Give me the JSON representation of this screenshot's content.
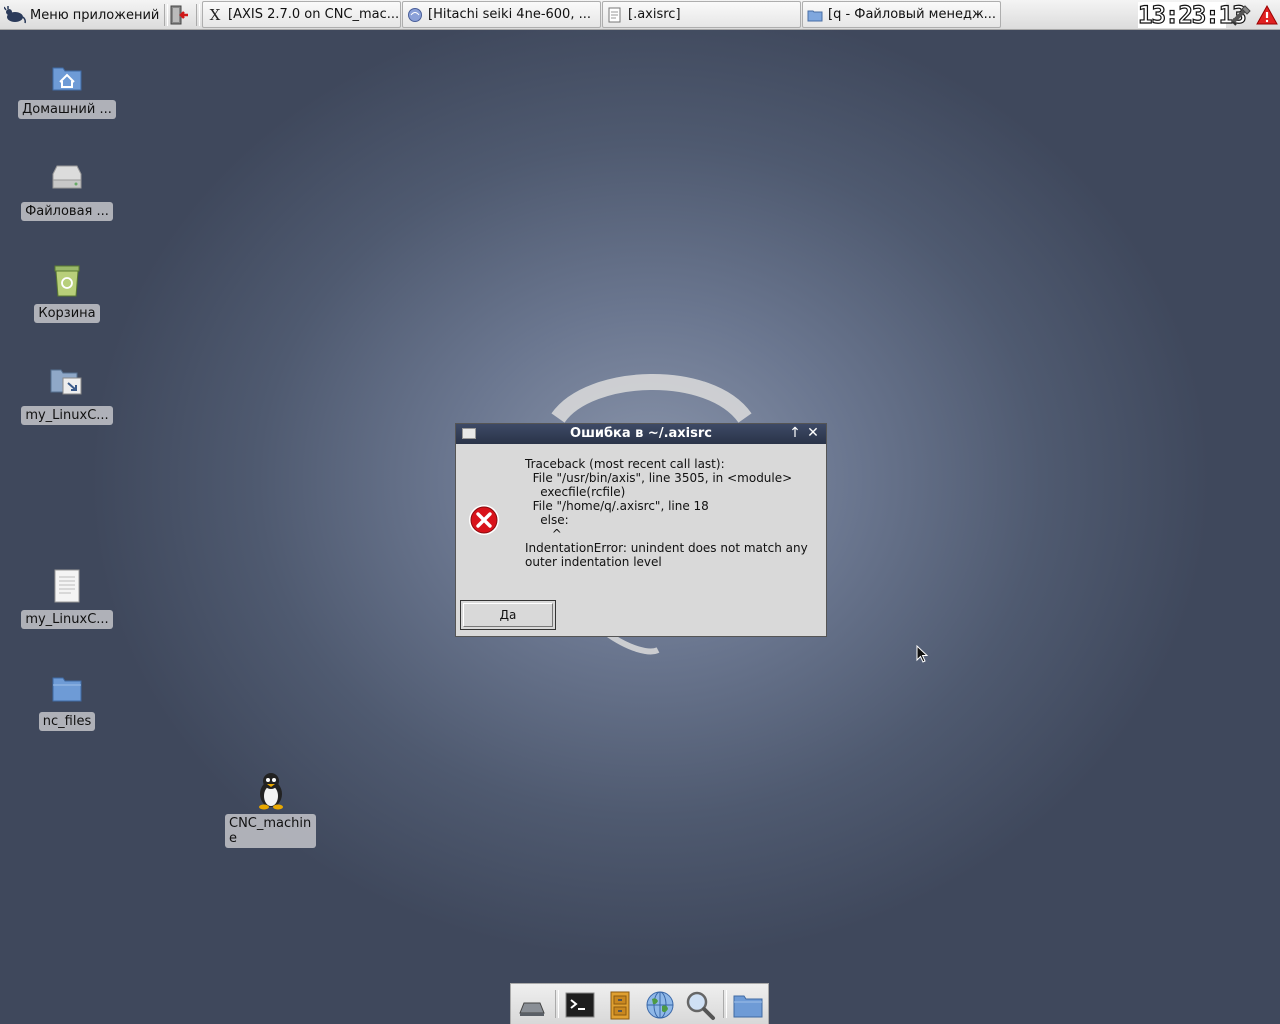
{
  "top_panel": {
    "menu_label": "Меню приложений",
    "tasks": [
      {
        "label": "[AXIS 2.7.0 on CNC_mac...",
        "icon": "x-icon"
      },
      {
        "label": "[Hitachi seiki 4ne-600, ...",
        "icon": "browser-icon"
      },
      {
        "label": "[.axisrc]",
        "icon": "text-editor-icon"
      },
      {
        "label": "[q - Файловый менедж...",
        "icon": "folder-icon"
      }
    ],
    "clock": "13:23:13"
  },
  "desktop_icons": [
    {
      "label": "Домашний ...",
      "icon": "home-folder-icon"
    },
    {
      "label": "Файловая ...",
      "icon": "drive-icon"
    },
    {
      "label": "Корзина",
      "icon": "trash-icon"
    },
    {
      "label": "my_LinuxC...",
      "icon": "folder-link-icon"
    },
    {
      "label": "my_LinuxC...",
      "icon": "text-file-icon"
    },
    {
      "label": "nc_files",
      "icon": "folder-icon"
    },
    {
      "label": "CNC_machine",
      "icon": "linuxcnc-icon"
    }
  ],
  "dialog": {
    "title": "Ошибка в ~/.axisrc",
    "message": "Traceback (most recent call last):\n  File \"/usr/bin/axis\", line 3505, in <module>\n    execfile(rcfile)\n  File \"/home/q/.axisrc\", line 18\n    else:\n       ^\nIndentationError: unindent does not match any\nouter indentation level",
    "ok_label": "Да"
  },
  "dock": [
    "show-desktop-icon",
    "terminal-icon",
    "file-cabinet-icon",
    "web-browser-icon",
    "search-icon",
    "folder-icon"
  ]
}
